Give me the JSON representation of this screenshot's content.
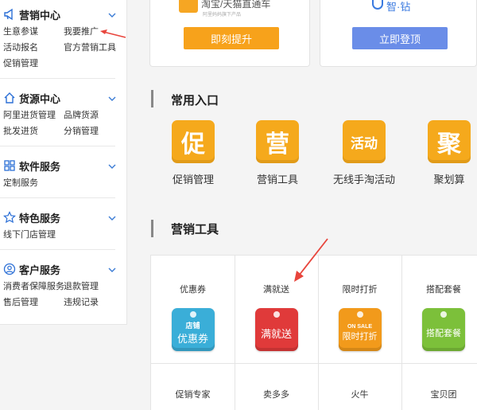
{
  "sidebar": {
    "sections": [
      {
        "title": "营销中心",
        "icon": "megaphone-icon",
        "links": [
          "生意参谋",
          "我要推广",
          "活动报名",
          "官方营销工具",
          "促销管理"
        ]
      },
      {
        "title": "货源中心",
        "icon": "home-icon",
        "links": [
          "阿里进货管理",
          "品牌货源",
          "批发进货",
          "分销管理"
        ]
      },
      {
        "title": "软件服务",
        "icon": "grid-icon",
        "links": [
          "定制服务"
        ]
      },
      {
        "title": "特色服务",
        "icon": "star-icon",
        "links": [
          "线下门店管理"
        ]
      },
      {
        "title": "客户服务",
        "icon": "user-icon",
        "links": [
          "消费者保障服务",
          "退款管理",
          "售后管理",
          "违规记录"
        ]
      }
    ]
  },
  "cards": {
    "tmall_logo": "淘宝/天猫直通车",
    "tmall_sub": "阿里妈妈旗下产品",
    "tmall_button": "即刻提升",
    "zuanzhan_logo": "智·钻",
    "zuanzhan_button": "立即登顶"
  },
  "common": {
    "title": "常用入口",
    "items": [
      {
        "glyph": "促",
        "label": "促销管理"
      },
      {
        "glyph": "营",
        "label": "营销工具"
      },
      {
        "glyph": "活动",
        "label": "无线手淘活动"
      },
      {
        "glyph": "聚",
        "label": "聚划算"
      }
    ]
  },
  "tools": {
    "title": "营销工具",
    "items": [
      {
        "title": "优惠券",
        "badge_top": "店铺",
        "badge_main": "优惠券",
        "color": "#3aaed8"
      },
      {
        "title": "满就送",
        "badge_top": "",
        "badge_main": "满就送",
        "color": "#e03a3a"
      },
      {
        "title": "限时打折",
        "badge_top": "ON SALE",
        "badge_main": "限时打折",
        "color": "#f29a1b"
      },
      {
        "title": "搭配套餐",
        "badge_top": "",
        "badge_main": "搭配套餐",
        "color": "#7cc03a"
      },
      {
        "title": "促销专家"
      },
      {
        "title": "卖多多"
      },
      {
        "title": "火牛"
      },
      {
        "title": "宝贝团"
      }
    ]
  },
  "colors": {
    "accent": "#2b6fd6",
    "orange": "#f5a91c",
    "arrow": "#e8453c"
  }
}
